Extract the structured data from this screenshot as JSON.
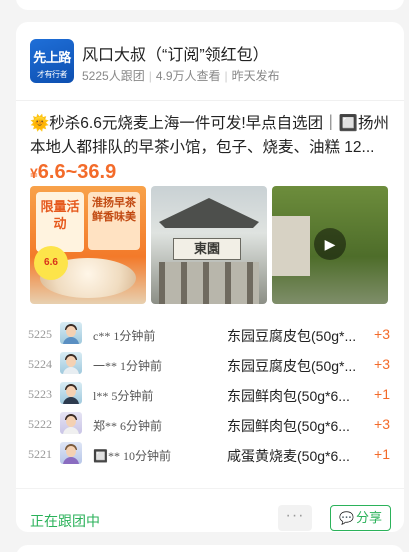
{
  "card": {
    "avatar_text_line1": "先上路",
    "avatar_text_line2": "才有行者",
    "title": "风口大叔（“订阅”领红包）",
    "followers": "5225人跟团",
    "views": "4.9万人查看",
    "posted": "昨天发布",
    "description": "🌞秒杀6.6元烧麦上海一件可发!早点自选团｜🔲扬州本地人都排队的早茶小馆，包子、烧麦、油糕 12...",
    "price_currency": "¥",
    "price_range": "6.6~36.9",
    "images": {
      "img1_badge": "限量活动",
      "img1_tag": "淮扬早茶鲜香味美",
      "img1_price": "6.6",
      "img2_sign": "東園",
      "img3_icon": "play-icon"
    }
  },
  "orders": [
    {
      "seq": "5225",
      "user": "c**",
      "time": "1分钟前",
      "item": "东园豆腐皮包(50g*...",
      "qty": "+3"
    },
    {
      "seq": "5224",
      "user": "一**",
      "time": "1分钟前",
      "item": "东园豆腐皮包(50g*...",
      "qty": "+3"
    },
    {
      "seq": "5223",
      "user": "l**",
      "time": "5分钟前",
      "item": "东园鲜肉包(50g*6...",
      "qty": "+1"
    },
    {
      "seq": "5222",
      "user": "郑**",
      "time": "6分钟前",
      "item": "东园鲜肉包(50g*6...",
      "qty": "+3"
    },
    {
      "seq": "5221",
      "user": "🔲**",
      "time": "10分钟前",
      "item": "咸蛋黄烧麦(50g*6...",
      "qty": "+1"
    }
  ],
  "footer": {
    "status": "正在跟团中",
    "more_label": "···",
    "share_label": "分享"
  }
}
